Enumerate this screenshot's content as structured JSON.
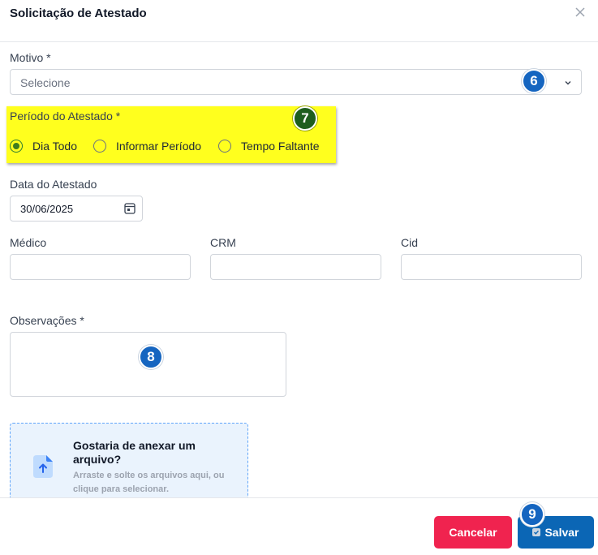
{
  "modal": {
    "title": "Solicitação de Atestado"
  },
  "motivo": {
    "label": "Motivo *",
    "placeholder": "Selecione"
  },
  "periodo": {
    "label": "Período do Atestado *",
    "options": [
      {
        "label": "Dia Todo",
        "checked": true
      },
      {
        "label": "Informar Período",
        "checked": false
      },
      {
        "label": "Tempo Faltante",
        "checked": false
      }
    ]
  },
  "data_atestado": {
    "label": "Data do Atestado",
    "value": "30/06/2025"
  },
  "medico": {
    "label": "Médico",
    "value": ""
  },
  "crm": {
    "label": "CRM",
    "value": ""
  },
  "cid": {
    "label": "Cid",
    "value": ""
  },
  "observacoes": {
    "label": "Observações *",
    "value": ""
  },
  "upload": {
    "title": "Gostaria de anexar um arquivo?",
    "subtitle": "Arraste e solte os arquivos aqui, ou clique para selecionar."
  },
  "footer": {
    "cancel_label": "Cancelar",
    "save_label": "Salvar"
  },
  "annotations": {
    "badge_6": "6",
    "badge_7": "7",
    "badge_8": "8",
    "badge_9": "9"
  },
  "colors": {
    "highlight": "#ffff1e",
    "primary": "#0b66b5",
    "danger": "#f0234f",
    "radio_checked": "#3f7d1e"
  }
}
